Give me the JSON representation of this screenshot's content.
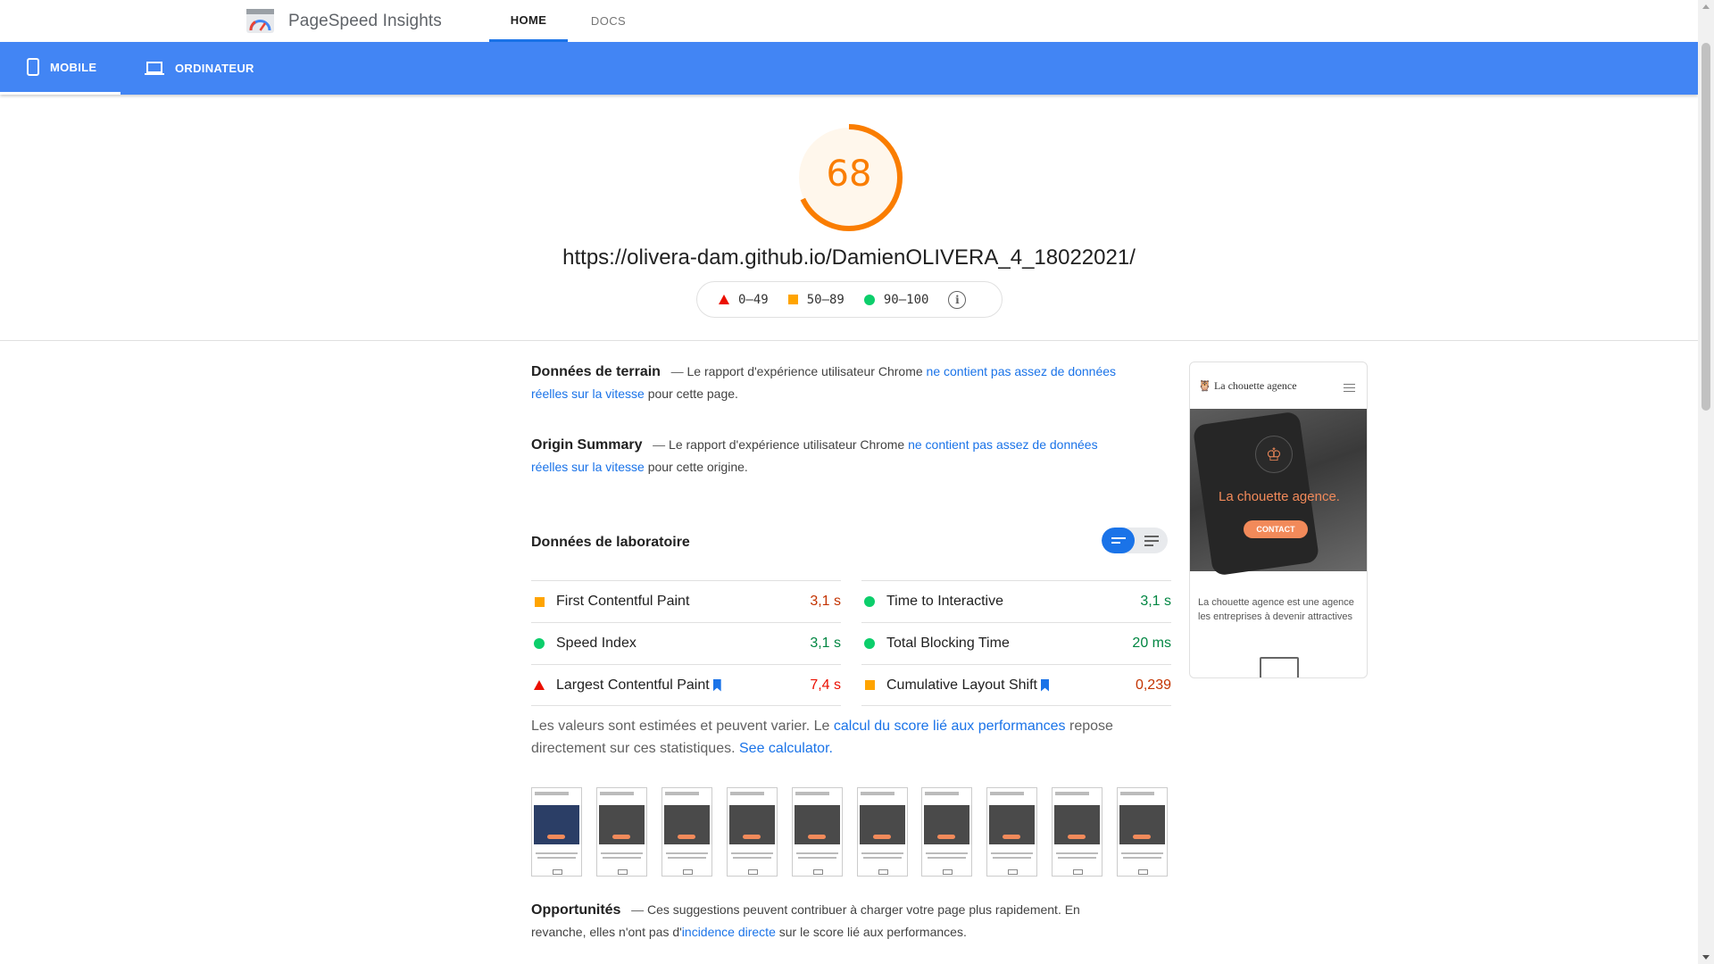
{
  "app": {
    "title": "PageSpeed Insights"
  },
  "nav": {
    "home": "HOME",
    "docs": "DOCS"
  },
  "devices": {
    "mobile": "MOBILE",
    "desktop": "ORDINATEUR"
  },
  "report": {
    "score": "68",
    "score_fraction": 0.68,
    "score_color": "#fa7d00",
    "url": "https://olivera-dam.github.io/DamienOLIVERA_4_18022021/",
    "legend": {
      "fail": "0–49",
      "average": "50–89",
      "pass": "90–100",
      "info_icon": "info-icon"
    }
  },
  "field_data": {
    "title": "Données de terrain",
    "dash": "—",
    "text_before": "Le rapport d'expérience utilisateur Chrome",
    "link": "ne contient pas assez de données réelles sur la vitesse",
    "text_after": "pour cette page."
  },
  "origin_summary": {
    "title": "Origin Summary",
    "dash": "—",
    "text_before": "Le rapport d'expérience utilisateur Chrome",
    "link": "ne contient pas assez de données réelles sur la vitesse",
    "text_after": "pour cette origine."
  },
  "lab_data": {
    "title": "Données de laboratoire",
    "metrics_left": [
      {
        "label": "First Contentful Paint",
        "value": "3,1 s",
        "status": "average",
        "bookmark": false
      },
      {
        "label": "Speed Index",
        "value": "3,1 s",
        "status": "pass",
        "bookmark": false
      },
      {
        "label": "Largest Contentful Paint",
        "value": "7,4 s",
        "status": "fail",
        "bookmark": true
      }
    ],
    "metrics_right": [
      {
        "label": "Time to Interactive",
        "value": "3,1 s",
        "status": "pass",
        "bookmark": false
      },
      {
        "label": "Total Blocking Time",
        "value": "20 ms",
        "status": "pass",
        "bookmark": false
      },
      {
        "label": "Cumulative Layout Shift",
        "value": "0,239",
        "status": "average",
        "bookmark": true
      }
    ],
    "estimate_before": "Les valeurs sont estimées et peuvent varier. Le",
    "estimate_link": "calcul du score lié aux performances",
    "estimate_after": "repose directement sur ces statistiques.",
    "calculator_link": "See calculator."
  },
  "opportunities": {
    "title": "Opportunités",
    "dash": "—",
    "text_before": "Ces suggestions peuvent contribuer à charger votre page plus rapidement. En revanche, elles n'ont pas d'",
    "link": "incidence directe",
    "text_after": "sur le score lié aux performances."
  },
  "preview": {
    "site_name": "La chouette agence",
    "hero_title": "La chouette agence.",
    "cta": "CONTACT",
    "body_text_1": "La chouette agence est une agence",
    "body_text_2": "les entreprises à devenir attractives"
  },
  "colors": {
    "brand_blue": "#4285f4",
    "link_blue": "#1a73e8",
    "fail": "#eb0f00",
    "average": "#ffa400",
    "pass": "#0cce6b"
  }
}
